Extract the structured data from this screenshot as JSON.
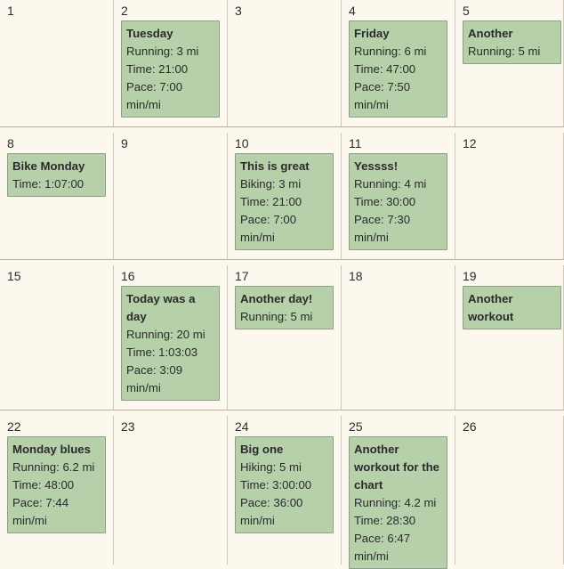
{
  "weeks": [
    {
      "days": [
        {
          "num": "1",
          "event": null
        },
        {
          "num": "2",
          "event": {
            "title": "Tuesday",
            "lines": [
              "Running: 3 mi",
              "Time: 21:00",
              "Pace: 7:00",
              "min/mi"
            ]
          }
        },
        {
          "num": "3",
          "event": null
        },
        {
          "num": "4",
          "event": {
            "title": "Friday",
            "lines": [
              "Running: 6 mi",
              "Time: 47:00",
              "Pace: 7:50",
              "min/mi"
            ]
          }
        },
        {
          "num": "5",
          "event": {
            "title": "Another",
            "lines": [
              "Running: 5 mi"
            ]
          }
        }
      ]
    },
    {
      "days": [
        {
          "num": "8",
          "event": {
            "title": "Bike Monday",
            "lines": [
              "Time: 1:07:00"
            ]
          }
        },
        {
          "num": "9",
          "event": null
        },
        {
          "num": "10",
          "event": {
            "title": "This is great",
            "lines": [
              "Biking: 3 mi",
              "Time: 21:00",
              "Pace: 7:00",
              "min/mi"
            ]
          }
        },
        {
          "num": "11",
          "event": {
            "title": "Yessss!",
            "lines": [
              "Running: 4 mi",
              "Time: 30:00",
              "Pace: 7:30",
              "min/mi"
            ]
          }
        },
        {
          "num": "12",
          "event": null
        }
      ]
    },
    {
      "days": [
        {
          "num": "15",
          "event": null
        },
        {
          "num": "16",
          "event": {
            "title": "Today was a day",
            "lines": [
              "Running: 20 mi",
              "Time: 1:03:03",
              "Pace: 3:09",
              "min/mi"
            ]
          }
        },
        {
          "num": "17",
          "event": {
            "title": "Another day!",
            "lines": [
              "Running: 5 mi"
            ]
          }
        },
        {
          "num": "18",
          "event": null
        },
        {
          "num": "19",
          "event": {
            "title": "Another workout",
            "lines": []
          }
        }
      ]
    },
    {
      "days": [
        {
          "num": "22",
          "event": {
            "title": "Monday blues",
            "lines": [
              "Running: 6.2 mi",
              "Time: 48:00",
              "Pace: 7:44",
              "min/mi"
            ]
          }
        },
        {
          "num": "23",
          "event": null
        },
        {
          "num": "24",
          "event": {
            "title": "Big one",
            "lines": [
              "Hiking: 5 mi",
              "Time: 3:00:00",
              "Pace: 36:00",
              "min/mi"
            ]
          }
        },
        {
          "num": "25",
          "event": {
            "title": "Another workout for the chart",
            "lines": [
              "Running: 4.2 mi",
              "Time: 28:30",
              "Pace: 6:47",
              "min/mi"
            ]
          }
        },
        {
          "num": "26",
          "event": null
        }
      ]
    }
  ]
}
